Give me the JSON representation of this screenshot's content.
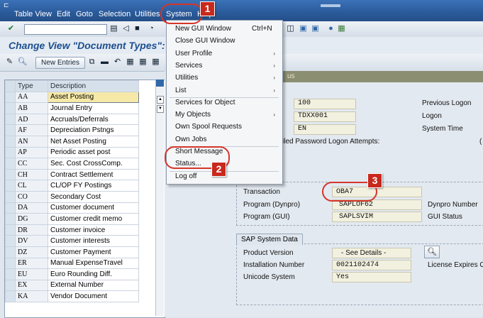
{
  "menubar": {
    "items": [
      "Table View",
      "Edit",
      "Goto",
      "Selection",
      "Utilities",
      "System",
      "Help"
    ]
  },
  "title": "Change View \"Document Types\":",
  "app_toolbar": {
    "new_entries": "New Entries"
  },
  "table": {
    "headers": [
      "Type",
      "Description"
    ],
    "rows": [
      [
        "AA",
        "Asset Posting"
      ],
      [
        "AB",
        "Journal Entry"
      ],
      [
        "AD",
        "Accruals/Deferrals"
      ],
      [
        "AF",
        "Depreciation Pstngs"
      ],
      [
        "AN",
        "Net Asset Posting"
      ],
      [
        "AP",
        "Periodic asset post"
      ],
      [
        "CC",
        "Sec. Cost CrossComp."
      ],
      [
        "CH",
        "Contract Settlement"
      ],
      [
        "CL",
        "CL/OP FY Postings"
      ],
      [
        "CO",
        "Secondary Cost"
      ],
      [
        "DA",
        "Customer document"
      ],
      [
        "DG",
        "Customer credit memo"
      ],
      [
        "DR",
        "Customer invoice"
      ],
      [
        "DV",
        "Customer interests"
      ],
      [
        "DZ",
        "Customer Payment"
      ],
      [
        "ER",
        "Manual ExpenseTravel"
      ],
      [
        "EU",
        "Euro Rounding Diff."
      ],
      [
        "EX",
        "External Number"
      ],
      [
        "KA",
        "Vendor Document"
      ]
    ]
  },
  "system_menu": {
    "items": [
      {
        "label": "New GUI Window",
        "shortcut": "Ctrl+N",
        "submenu": false
      },
      {
        "label": "Close GUI Window",
        "shortcut": "",
        "submenu": false
      },
      {
        "label": "User Profile",
        "shortcut": "",
        "submenu": true
      },
      {
        "label": "Services",
        "shortcut": "",
        "submenu": true
      },
      {
        "label": "Utilities",
        "shortcut": "",
        "submenu": true
      },
      {
        "label": "List",
        "shortcut": "",
        "submenu": true
      },
      {
        "label": "Services for Object",
        "shortcut": "",
        "submenu": false
      },
      {
        "label": "My Objects",
        "shortcut": "",
        "submenu": true
      },
      {
        "label": "Own Spool Requests",
        "shortcut": "",
        "submenu": false
      },
      {
        "label": "Own Jobs",
        "shortcut": "",
        "submenu": false
      },
      {
        "label": "Short Message",
        "shortcut": "",
        "submenu": false
      },
      {
        "label": "Status...",
        "shortcut": "",
        "submenu": false
      },
      {
        "label": "Log off",
        "shortcut": "",
        "submenu": false
      }
    ]
  },
  "status_dialog": {
    "title_fragment": "us",
    "client": "100",
    "user": "TDXX001",
    "language": "EN",
    "failed_logon_label": "iled Password Logon Attempts:",
    "previous_logon_label": "Previous Logon",
    "logon_label": "Logon",
    "system_time_label": "System Time",
    "repository_tab": "ata",
    "transaction_label": "Transaction",
    "transaction_value": "OBA7",
    "program_dynpro_label": "Program (Dynpro)",
    "program_dynpro_value": "SAPLOF62",
    "program_gui_label": "Program (GUI)",
    "program_gui_value": "SAPLSVIM",
    "dynpro_number_label": "Dynpro Number",
    "gui_status_label": "GUI Status",
    "sap_system_tab": "SAP System Data",
    "product_version_label": "Product Version",
    "product_version_value": "- See Details -",
    "installation_number_label": "Installation Number",
    "installation_number_value": "0021102474",
    "license_expires_label": "License Expires On",
    "unicode_label": "Unicode System",
    "unicode_value": "Yes"
  },
  "annotations": {
    "badge1": "1",
    "badge2": "2",
    "badge3": "3"
  },
  "colors": {
    "accent": "#1d4f91",
    "annotation_red": "#c9281d",
    "menubar": "#2a5a9a"
  }
}
